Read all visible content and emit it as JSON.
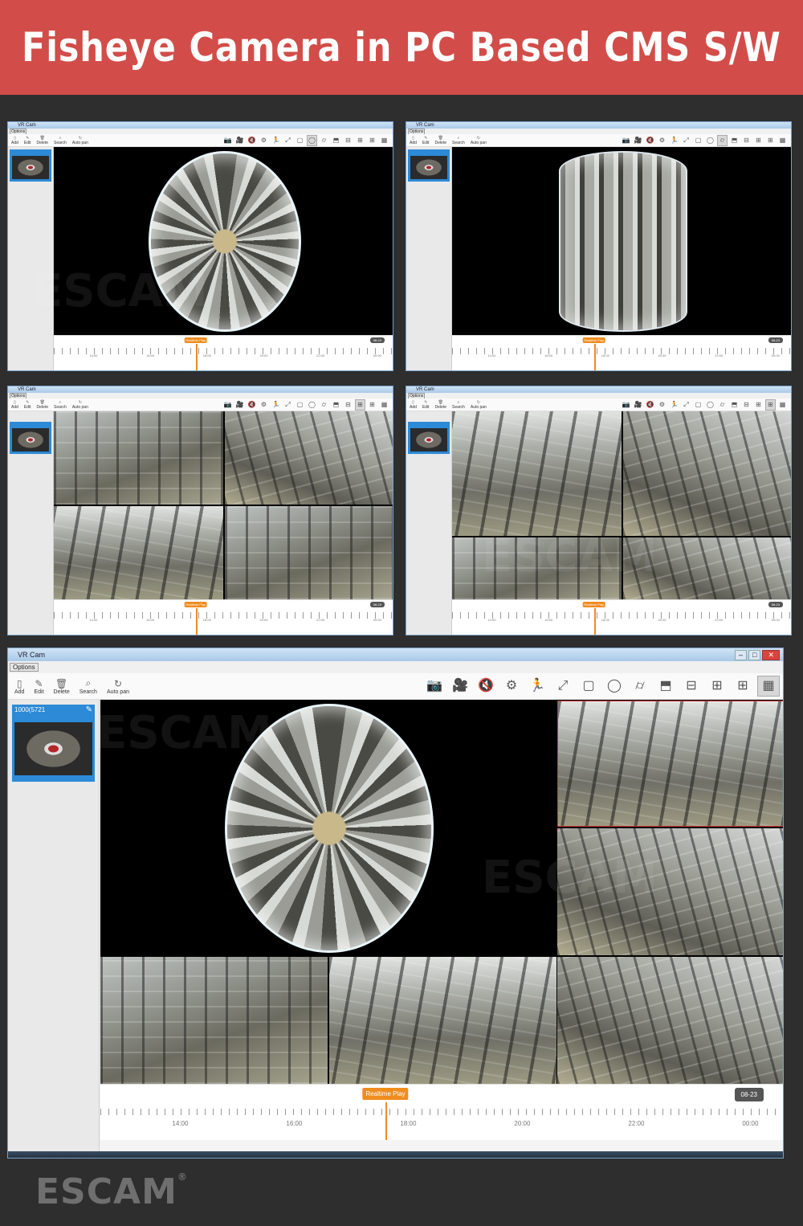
{
  "banner": {
    "title": "Fisheye Camera in PC Based CMS S/W"
  },
  "app": {
    "window_title": "VR Cam",
    "menu_options": "Options",
    "tools": [
      {
        "label": "Add",
        "icon": "add-file-icon"
      },
      {
        "label": "Edit",
        "icon": "edit-icon"
      },
      {
        "label": "Delete",
        "icon": "trash-icon"
      },
      {
        "label": "Search",
        "icon": "search-icon"
      },
      {
        "label": "Auto pan",
        "icon": "auto-pan-icon"
      }
    ],
    "right_tools": [
      {
        "name": "snapshot-camera-icon",
        "glyph": "📷"
      },
      {
        "name": "record-video-icon",
        "glyph": "🎥"
      },
      {
        "name": "mute-speaker-icon",
        "glyph": "🔇"
      },
      {
        "name": "settings-gear-icon",
        "glyph": "⚙"
      },
      {
        "name": "motion-run-icon",
        "glyph": "🏃"
      },
      {
        "name": "fullscreen-icon",
        "glyph": "⤢"
      },
      {
        "name": "view-original-icon",
        "glyph": "▢"
      },
      {
        "name": "view-fisheye-icon",
        "glyph": "◯"
      },
      {
        "name": "view-cylinder-icon",
        "glyph": "⌭"
      },
      {
        "name": "view-panorama-icon",
        "glyph": "⬒"
      },
      {
        "name": "view-split-2-icon",
        "glyph": "⊟"
      },
      {
        "name": "view-split-4-icon",
        "glyph": "⊞"
      },
      {
        "name": "view-split-4b-icon",
        "glyph": "⊞"
      },
      {
        "name": "view-split-6-icon",
        "glyph": "▦"
      }
    ],
    "camera_label": "1000(5721",
    "timeline": {
      "labels": [
        "14:00",
        "16:00",
        "18:00",
        "20:00",
        "22:00",
        "00:00"
      ],
      "realtime_label": "Realtime Play",
      "date_badge": "08-23"
    }
  },
  "footer": {
    "brand": "ESCAM"
  },
  "watermark": "ESCAM"
}
